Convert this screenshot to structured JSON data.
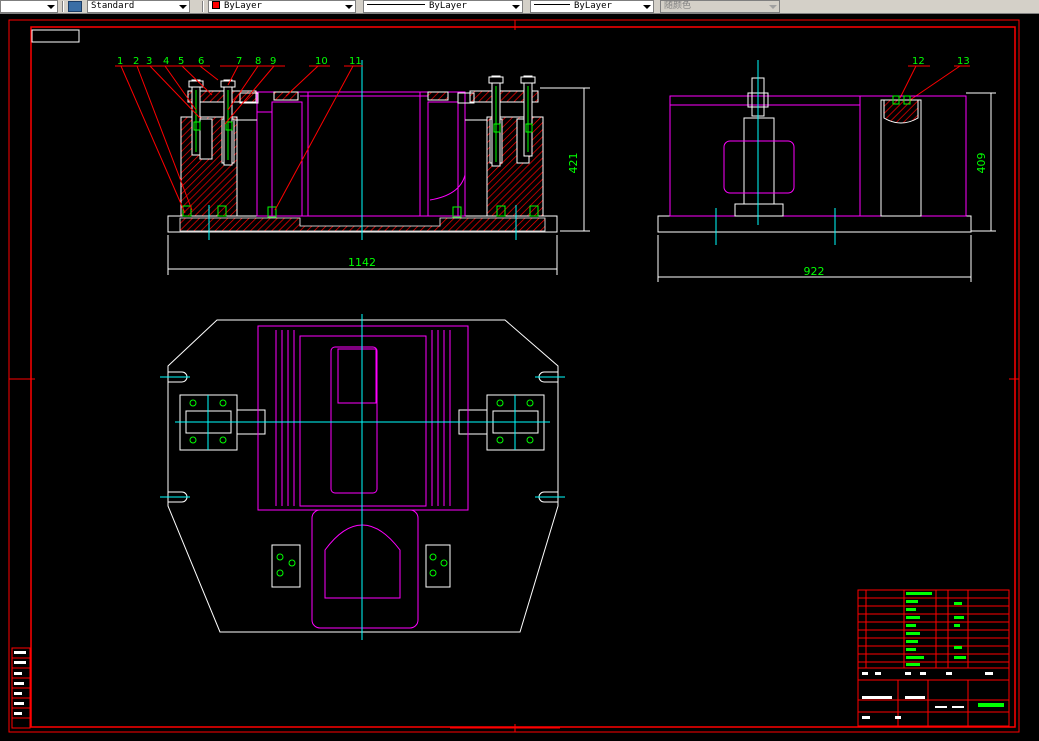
{
  "toolbar": {
    "text_style": "Standard",
    "layer_color": "ByLayer",
    "linetype": "ByLayer",
    "lineweight": "ByLayer",
    "plot_style": "随颜色"
  },
  "colors": {
    "accent_red": "#ff0000",
    "cad_green": "#00ff00",
    "cad_magenta": "#ff00ff",
    "cad_cyan": "#00ffff",
    "cad_white": "#ffffff"
  },
  "drawing": {
    "part_balloons": [
      "1",
      "2",
      "3",
      "4",
      "5",
      "6",
      "7",
      "8",
      "9",
      "10",
      "11",
      "12",
      "13"
    ],
    "dimensions": {
      "front_height": "421",
      "front_width": "1142",
      "side_height": "409",
      "side_width": "922"
    }
  }
}
